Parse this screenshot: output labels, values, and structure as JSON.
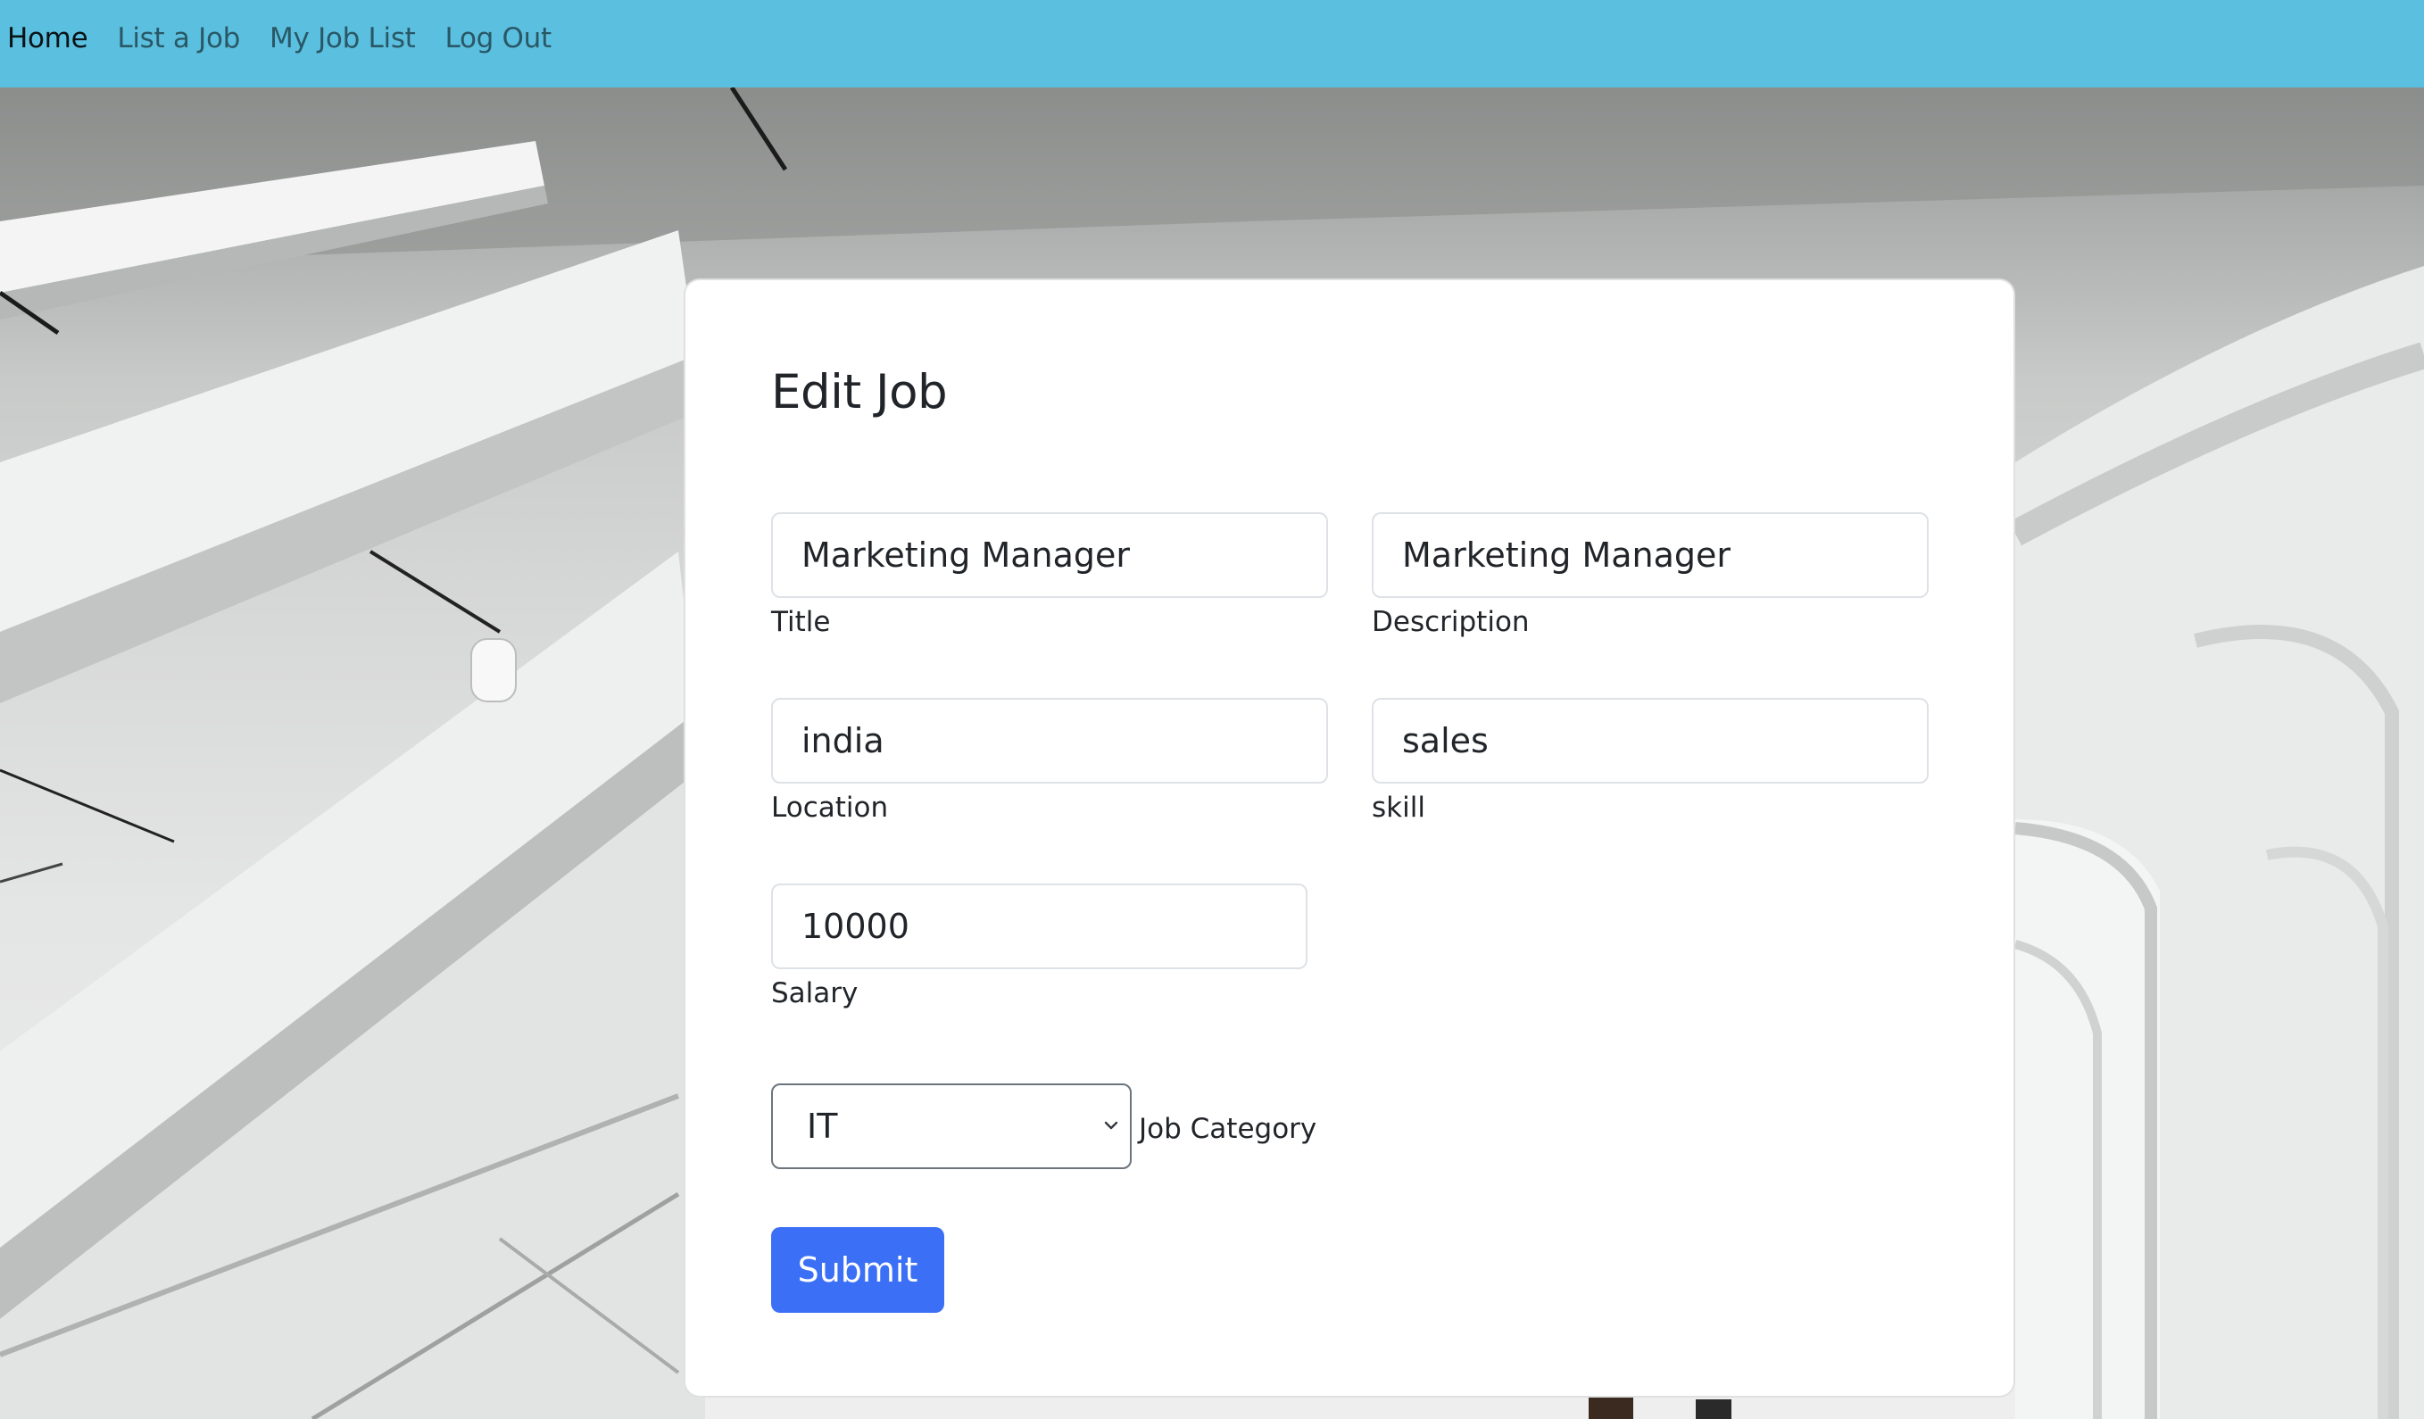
{
  "nav": {
    "items": [
      {
        "label": "Home",
        "active": true
      },
      {
        "label": "List a Job",
        "active": false
      },
      {
        "label": "My Job List",
        "active": false
      },
      {
        "label": "Log Out",
        "active": false
      }
    ]
  },
  "form": {
    "title": "Edit Job",
    "fields": {
      "title": {
        "value": "Marketing Manager",
        "label": "Title"
      },
      "description": {
        "value": "Marketing Manager",
        "label": "Description"
      },
      "location": {
        "value": "india",
        "label": "Location"
      },
      "skill": {
        "value": "sales",
        "label": "skill"
      },
      "salary": {
        "value": "10000",
        "label": "Salary"
      }
    },
    "category": {
      "selected": "IT",
      "label": "Job Category"
    },
    "submit_label": "Submit"
  },
  "colors": {
    "navbar": "#5bc0e0",
    "submit": "#3b6ff6",
    "card": "#ffffff"
  }
}
